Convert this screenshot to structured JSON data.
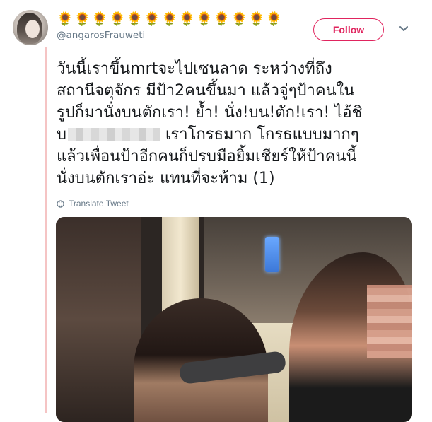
{
  "author": {
    "display_name": "🌻🌻🌻🌻🌻🌻🌻🌻🌻🌻🌻🌻🌻",
    "username": "@angarosFrauweti"
  },
  "actions": {
    "follow_label": "Follow",
    "more_icon": "chevron-down-icon"
  },
  "tweet": {
    "text_part1": "วันนี้เราขึ้นmrtจะไปเซนลาด ระหว่างที่ถึง\nสถานีจตุจักร มีป้า2คนขึ้นมา แล้วจู่ๆป้าคนใน\nรูปก็มานั่งบนตักเรา! ย้ำ! นั่ง!บน!ตัก!เรา! ไอ้ชิ\nบ",
    "text_part2": "เราโกรธมาก โกรธแบบมากๆ\nแล้วเพื่อนป้าอีกคนก็ปรบมือยิ้มเชียร์ให้ป้าคนนี้\nนั่งบนตักเราอ่ะ แทนที่จะห้าม (1)",
    "translate_label": "Translate Tweet"
  },
  "colors": {
    "accent": "#e0245e",
    "muted": "#657786",
    "thread_line": "#f5c4c4"
  }
}
